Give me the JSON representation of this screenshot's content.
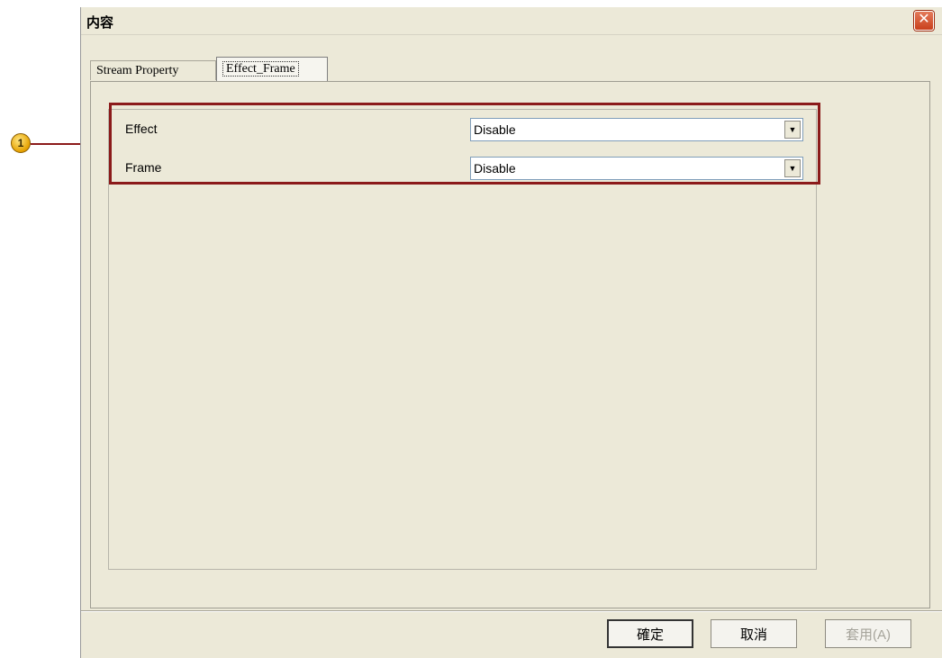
{
  "callout": {
    "number": "1"
  },
  "window": {
    "title": "内容",
    "close_label": "✕"
  },
  "tabs": [
    {
      "label": "Stream Property"
    },
    {
      "label": "Effect_Frame"
    }
  ],
  "settings": {
    "effect": {
      "label": "Effect",
      "value": "Disable"
    },
    "frame": {
      "label": "Frame",
      "value": "Disable"
    }
  },
  "icons": {
    "dropdown": "chevron-down-icon",
    "close": "close-icon"
  },
  "buttons": {
    "ok": "確定",
    "cancel": "取消",
    "apply": "套用(A)"
  },
  "colors": {
    "highlight": "#8b1a1a",
    "callout": "#e6a100",
    "dialog_bg": "#ece9d8"
  }
}
